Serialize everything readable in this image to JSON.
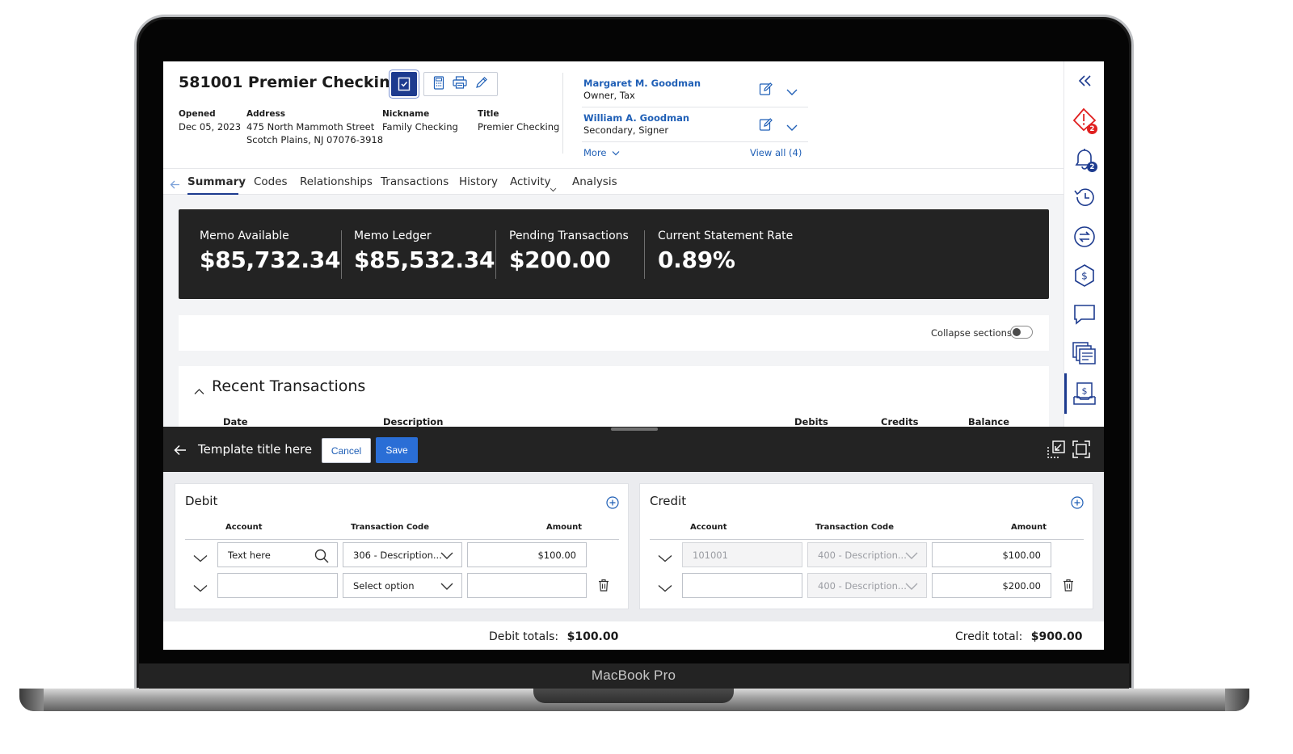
{
  "device": {
    "brand_label": "MacBook Pro"
  },
  "account": {
    "title": "581001 Premier Checking",
    "opened_label": "Opened",
    "opened_value": "Dec 05, 2023",
    "address_label": "Address",
    "address_line1": "475 North Mammoth Street",
    "address_line2": "Scotch Plains, NJ 07076-3918",
    "nickname_label": "Nickname",
    "nickname_value": "Family Checking",
    "title_label": "Title",
    "title_value": "Premier Checking"
  },
  "people": [
    {
      "name": "Margaret M. Goodman",
      "role": "Owner, Tax"
    },
    {
      "name": "William A. Goodman",
      "role": "Secondary, Signer"
    }
  ],
  "people_links": {
    "more": "More",
    "view_all": "View all (4)"
  },
  "tabs": [
    "Summary",
    "Codes",
    "Relationships",
    "Transactions",
    "History",
    "Activity",
    "Analysis"
  ],
  "active_tab": "Summary",
  "rail": {
    "alert_badge": "2",
    "bell_badge": "2",
    "icons": [
      "collapse-rail-icon",
      "alert-icon",
      "notification-icon",
      "history-icon",
      "transfer-icon",
      "dollar-icon",
      "message-icon",
      "statements-icon",
      "deposit-icon"
    ]
  },
  "metrics": [
    {
      "label": "Memo Available",
      "value": "$85,732.34"
    },
    {
      "label": "Memo Ledger",
      "value": "$85,532.34"
    },
    {
      "label": "Pending Transactions",
      "value": "$200.00"
    },
    {
      "label": "Current Statement Rate",
      "value": "0.89%"
    }
  ],
  "collapse_sections": {
    "label": "Collapse sections",
    "on": false
  },
  "recent": {
    "title": "Recent Transactions",
    "columns": [
      "Date",
      "Description",
      "Debits",
      "Credits",
      "Balance"
    ]
  },
  "drawer": {
    "title": "Template title here",
    "cancel": "Cancel",
    "save": "Save"
  },
  "debit": {
    "title": "Debit",
    "columns": [
      "Account",
      "Transaction Code",
      "Amount"
    ],
    "rows": [
      {
        "account": "Text here",
        "code": "306 - Description...",
        "amount": "$100.00"
      },
      {
        "account": "",
        "code": "Select option",
        "amount": ""
      }
    ]
  },
  "credit": {
    "title": "Credit",
    "columns": [
      "Account",
      "Transaction Code",
      "Amount"
    ],
    "rows": [
      {
        "account": "101001",
        "code": "400 - Description...",
        "amount": "$100.00"
      },
      {
        "account": "",
        "code": "400 - Description...",
        "amount": "$200.00"
      }
    ]
  },
  "totals": {
    "debit_label": "Debit totals:",
    "debit_value": "$100.00",
    "credit_label": "Credit total:",
    "credit_value": "$900.00"
  },
  "colors": {
    "accent": "#1d3b8f",
    "link": "#1f5fb6",
    "primary_button": "#2a6ed6",
    "alert": "#e02020",
    "dark_panel": "#232323"
  }
}
